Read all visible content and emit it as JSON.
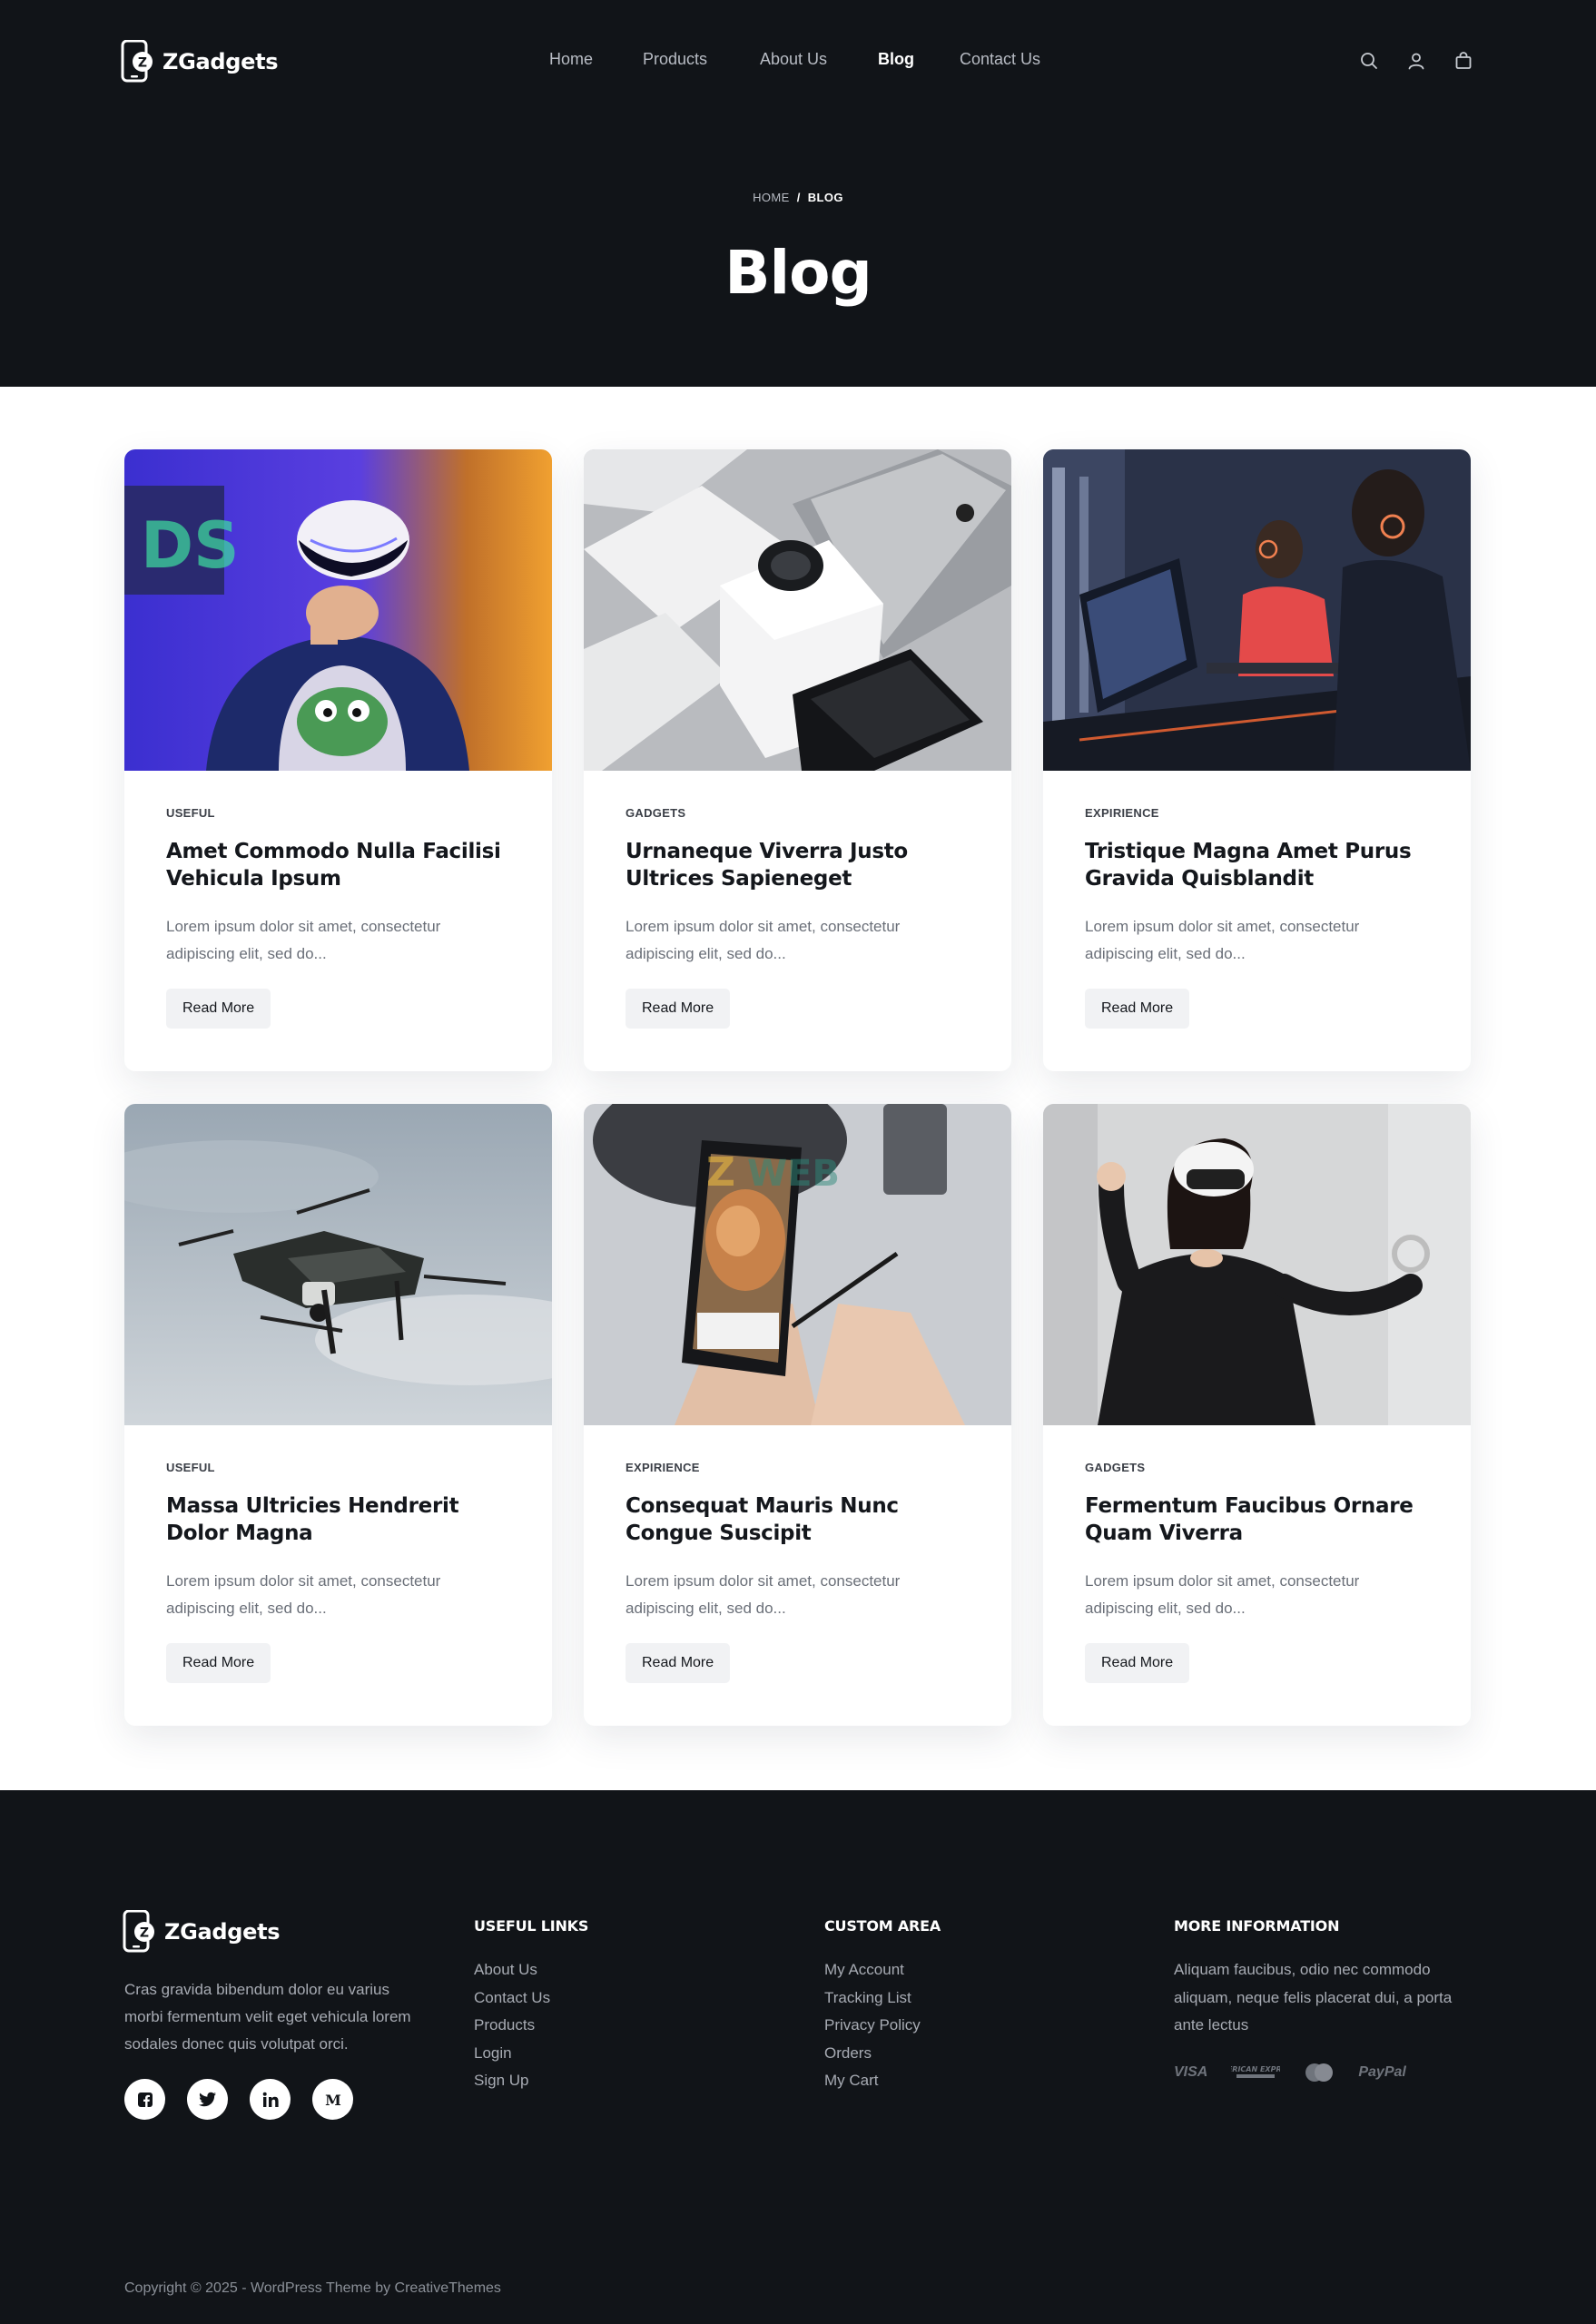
{
  "brand": {
    "name": "ZGadgets",
    "logo_letter": "Z"
  },
  "nav": {
    "items": [
      {
        "label": "Home",
        "active": false
      },
      {
        "label": "Products",
        "active": false
      },
      {
        "label": "About Us",
        "active": false
      },
      {
        "label": "Blog",
        "active": true
      },
      {
        "label": "Contact Us",
        "active": false
      }
    ],
    "icons": [
      "search-icon",
      "user-icon",
      "cart-icon"
    ]
  },
  "hero": {
    "breadcrumb": {
      "home": "HOME",
      "separator": "/",
      "current": "BLOG"
    },
    "title": "Blog"
  },
  "posts": [
    {
      "category": "USEFUL",
      "title": "Amet Commodo Nulla Facilisi Vehicula Ipsum",
      "excerpt": "Lorem ipsum dolor sit amet, consectetur adipiscing elit, sed do...",
      "button": "Read More",
      "image": "vr-headset-boy"
    },
    {
      "category": "GADGETS",
      "title": "Urnaneque Viverra Justo Ultrices Sapieneget",
      "excerpt": "Lorem ipsum dolor sit amet, consectetur adipiscing elit, sed do...",
      "button": "Read More",
      "image": "smartwatch-laptop-desk"
    },
    {
      "category": "EXPIRIENCE",
      "title": "Tristique Magna Amet Purus Gravida Quisblandit",
      "excerpt": "Lorem ipsum dolor sit amet, consectetur adipiscing elit, sed do...",
      "button": "Read More",
      "image": "gamers-computer-room"
    },
    {
      "category": "USEFUL",
      "title": "Massa Ultricies Hendrerit Dolor Magna",
      "excerpt": "Lorem ipsum dolor sit amet, consectetur adipiscing elit, sed do...",
      "button": "Read More",
      "image": "drone-sky"
    },
    {
      "category": "EXPIRIENCE",
      "title": "Consequat Mauris Nunc Congue Suscipit",
      "excerpt": "Lorem ipsum dolor sit amet, consectetur adipiscing elit, sed do...",
      "button": "Read More",
      "image": "phone-stylus-hands"
    },
    {
      "category": "GADGETS",
      "title": "Fermentum Faucibus Ornare Quam Viverra",
      "excerpt": "Lorem ipsum dolor sit amet, consectetur adipiscing elit, sed do...",
      "button": "Read More",
      "image": "woman-vr-controllers"
    }
  ],
  "footer": {
    "about": "Cras gravida bibendum dolor eu varius morbi fermentum velit eget vehicula lorem sodales donec quis volutpat orci.",
    "socials": [
      "facebook-icon",
      "twitter-icon",
      "linkedin-icon",
      "medium-icon"
    ],
    "useful_links": {
      "heading": "USEFUL LINKS",
      "items": [
        "About Us",
        "Contact Us",
        "Products",
        "Login",
        "Sign Up"
      ]
    },
    "custom_area": {
      "heading": "CUSTOM AREA",
      "items": [
        "My Account",
        "Tracking List",
        "Privacy Policy",
        "Orders",
        "My Cart"
      ]
    },
    "more_info": {
      "heading": "MORE INFORMATION",
      "text": "Aliquam faucibus, odio nec commodo aliquam, neque felis placerat dui, a porta ante lectus"
    },
    "payments": [
      "VISA",
      "AMERICAN EXPRESS",
      "mastercard-icon",
      "PayPal"
    ],
    "copyright": "Copyright © 2025 - WordPress Theme by CreativeThemes"
  },
  "colors": {
    "dark": "#111418",
    "white": "#ffffff",
    "muted": "#a7abb3",
    "button_bg": "#f1f2f4"
  }
}
